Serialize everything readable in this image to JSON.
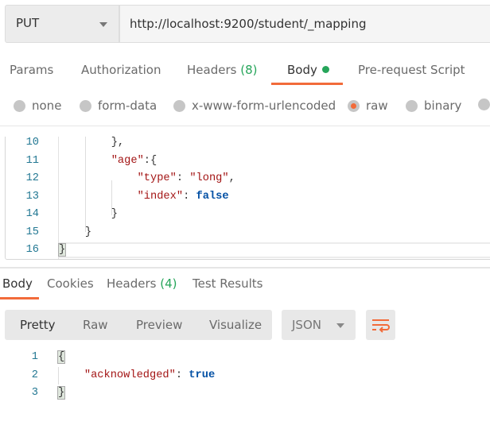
{
  "request": {
    "method": "PUT",
    "url": "http://localhost:9200/student/_mapping",
    "tabs": [
      {
        "label": "Params"
      },
      {
        "label": "Authorization"
      },
      {
        "label": "Headers",
        "count": "(8)"
      },
      {
        "label": "Body",
        "active": true
      },
      {
        "label": "Pre-request Script"
      }
    ],
    "body_types": [
      {
        "label": "none"
      },
      {
        "label": "form-data"
      },
      {
        "label": "x-www-form-urlencoded"
      },
      {
        "label": "raw",
        "selected": true
      },
      {
        "label": "binary"
      }
    ],
    "editor": {
      "line_numbers": [
        "10",
        "11",
        "12",
        "13",
        "14",
        "15",
        "16"
      ],
      "lines": [
        [
          {
            "t": "        },",
            "c": "p"
          }
        ],
        [
          {
            "t": "        ",
            "c": "p"
          },
          {
            "t": "\"age\"",
            "c": "k"
          },
          {
            "t": ":{",
            "c": "p"
          }
        ],
        [
          {
            "t": "            ",
            "c": "p"
          },
          {
            "t": "\"type\"",
            "c": "k"
          },
          {
            "t": ": ",
            "c": "p"
          },
          {
            "t": "\"long\"",
            "c": "s"
          },
          {
            "t": ",",
            "c": "p"
          }
        ],
        [
          {
            "t": "            ",
            "c": "p"
          },
          {
            "t": "\"index\"",
            "c": "k"
          },
          {
            "t": ": ",
            "c": "p"
          },
          {
            "t": "false",
            "c": "b"
          }
        ],
        [
          {
            "t": "        }",
            "c": "p"
          }
        ],
        [
          {
            "t": "    }",
            "c": "p"
          }
        ],
        [
          {
            "t": "}",
            "c": "p bm"
          }
        ]
      ]
    }
  },
  "response": {
    "tabs": [
      {
        "label": "Body",
        "active": true
      },
      {
        "label": "Cookies"
      },
      {
        "label": "Headers",
        "count": "(4)"
      },
      {
        "label": "Test Results"
      }
    ],
    "view_modes": [
      "Pretty",
      "Raw",
      "Preview",
      "Visualize"
    ],
    "format": "JSON",
    "wrap_icon": "wrap-lines-icon",
    "line_numbers": [
      "1",
      "2",
      "3"
    ],
    "lines": [
      [
        {
          "t": "{",
          "c": "p bm"
        }
      ],
      [
        {
          "t": "    ",
          "c": "p"
        },
        {
          "t": "\"acknowledged\"",
          "c": "k"
        },
        {
          "t": ": ",
          "c": "p"
        },
        {
          "t": "true",
          "c": "b"
        }
      ],
      [
        {
          "t": "}",
          "c": "p bm"
        }
      ]
    ]
  },
  "colors": {
    "accent": "#f26b3a",
    "green": "#26a55a"
  }
}
